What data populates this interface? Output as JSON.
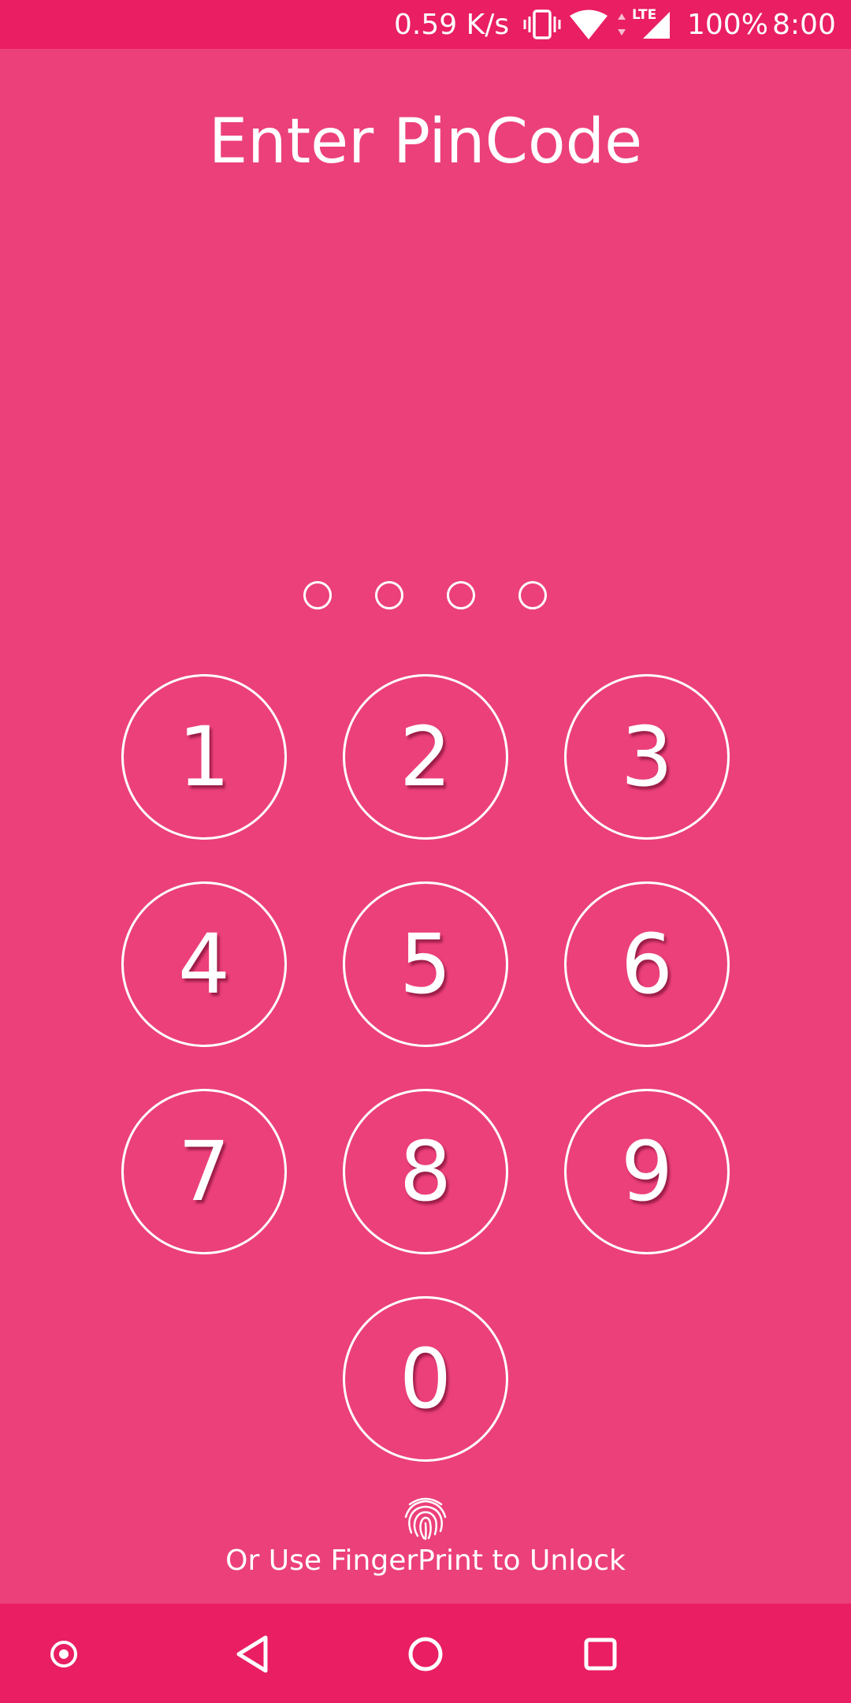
{
  "status_bar": {
    "network_speed": "0.59 K/s",
    "network_type": "LTE",
    "battery": "100%",
    "time": "8:00",
    "icons": [
      "vibrate-icon",
      "wifi-icon",
      "data-arrows-icon",
      "cell-signal-icon"
    ]
  },
  "title": "Enter PinCode",
  "pin": {
    "length": 4,
    "filled": 0
  },
  "keypad": {
    "keys": [
      "1",
      "2",
      "3",
      "4",
      "5",
      "6",
      "7",
      "8",
      "9",
      "0"
    ]
  },
  "fingerprint": {
    "icon": "fingerprint-icon",
    "label": "Or Use FingerPrint to Unlock"
  },
  "nav_bar": {
    "buttons": [
      "assistant-icon",
      "back-icon",
      "home-icon",
      "recents-icon"
    ]
  },
  "colors": {
    "background": "#EC407A",
    "bars": "#E91E63",
    "foreground": "#FFFFFF"
  }
}
